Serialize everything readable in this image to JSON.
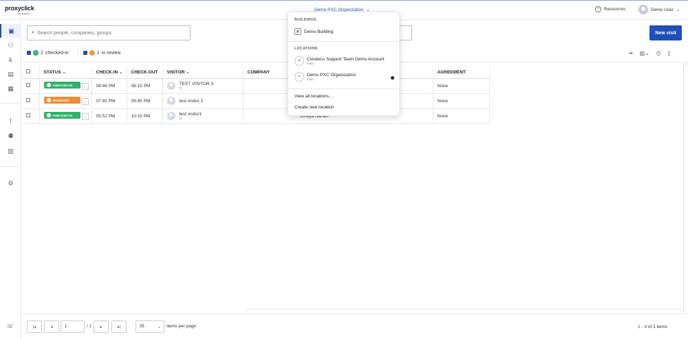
{
  "brand": {
    "name": "proxyclick",
    "sub": "by eptura"
  },
  "header": {
    "org_selector": "Demo PXC Organization",
    "resources": "Resources",
    "user": "Demo User"
  },
  "search": {
    "placeholder": "Search people, companies, groups"
  },
  "new_visit_label": "New visit",
  "filters": [
    {
      "count": "2",
      "label": "checked-in",
      "color": "#2fb36b"
    },
    {
      "count": "1",
      "label": "in review",
      "color": "#f39232"
    }
  ],
  "columns": [
    "STATUS",
    "CHECK-IN",
    "CHECK-OUT",
    "VISITOR",
    "COMPANY",
    "AGREEMENT"
  ],
  "rows": [
    {
      "status": "CHECKED-IN",
      "status_color": "#2fb36b",
      "checkin": "08:46 PM",
      "checkout": "08:15 PM",
      "visitor": "TEST VISITOR 3",
      "visitor_icon": "mail-icon",
      "agreement": "None"
    },
    {
      "status": "IN REVIEW",
      "status_color": "#f38a2e",
      "checkin": "07:45 PM",
      "checkout": "09:45 PM",
      "visitor": "test visitor 2",
      "visitor_icon": "",
      "agreement": "None"
    },
    {
      "status": "CHECKED-IN",
      "status_color": "#2fb36b",
      "checkin": "05:52 PM",
      "checkout": "10:15 PM",
      "visitor": "test visitor1",
      "visitor_icon": "sync-icon",
      "host_partial": "Shreya Nahan",
      "agreement": "None"
    }
  ],
  "dropdown": {
    "buildings_heading": "BUILDINGS",
    "building": "Demo Building",
    "locations_heading": "LOCATIONS",
    "locations": [
      {
        "name": "Condeco Support Team Demo Account",
        "country": "India"
      },
      {
        "name": "Demo PXC Organization",
        "country": "India",
        "selected": true
      }
    ],
    "view_all": "View all locations...",
    "create_new": "Create new location"
  },
  "pager": {
    "page": "1",
    "of": "/ 1",
    "page_size": "25",
    "items_label": "items per page",
    "summary": "1 - 3 of 3 items"
  }
}
